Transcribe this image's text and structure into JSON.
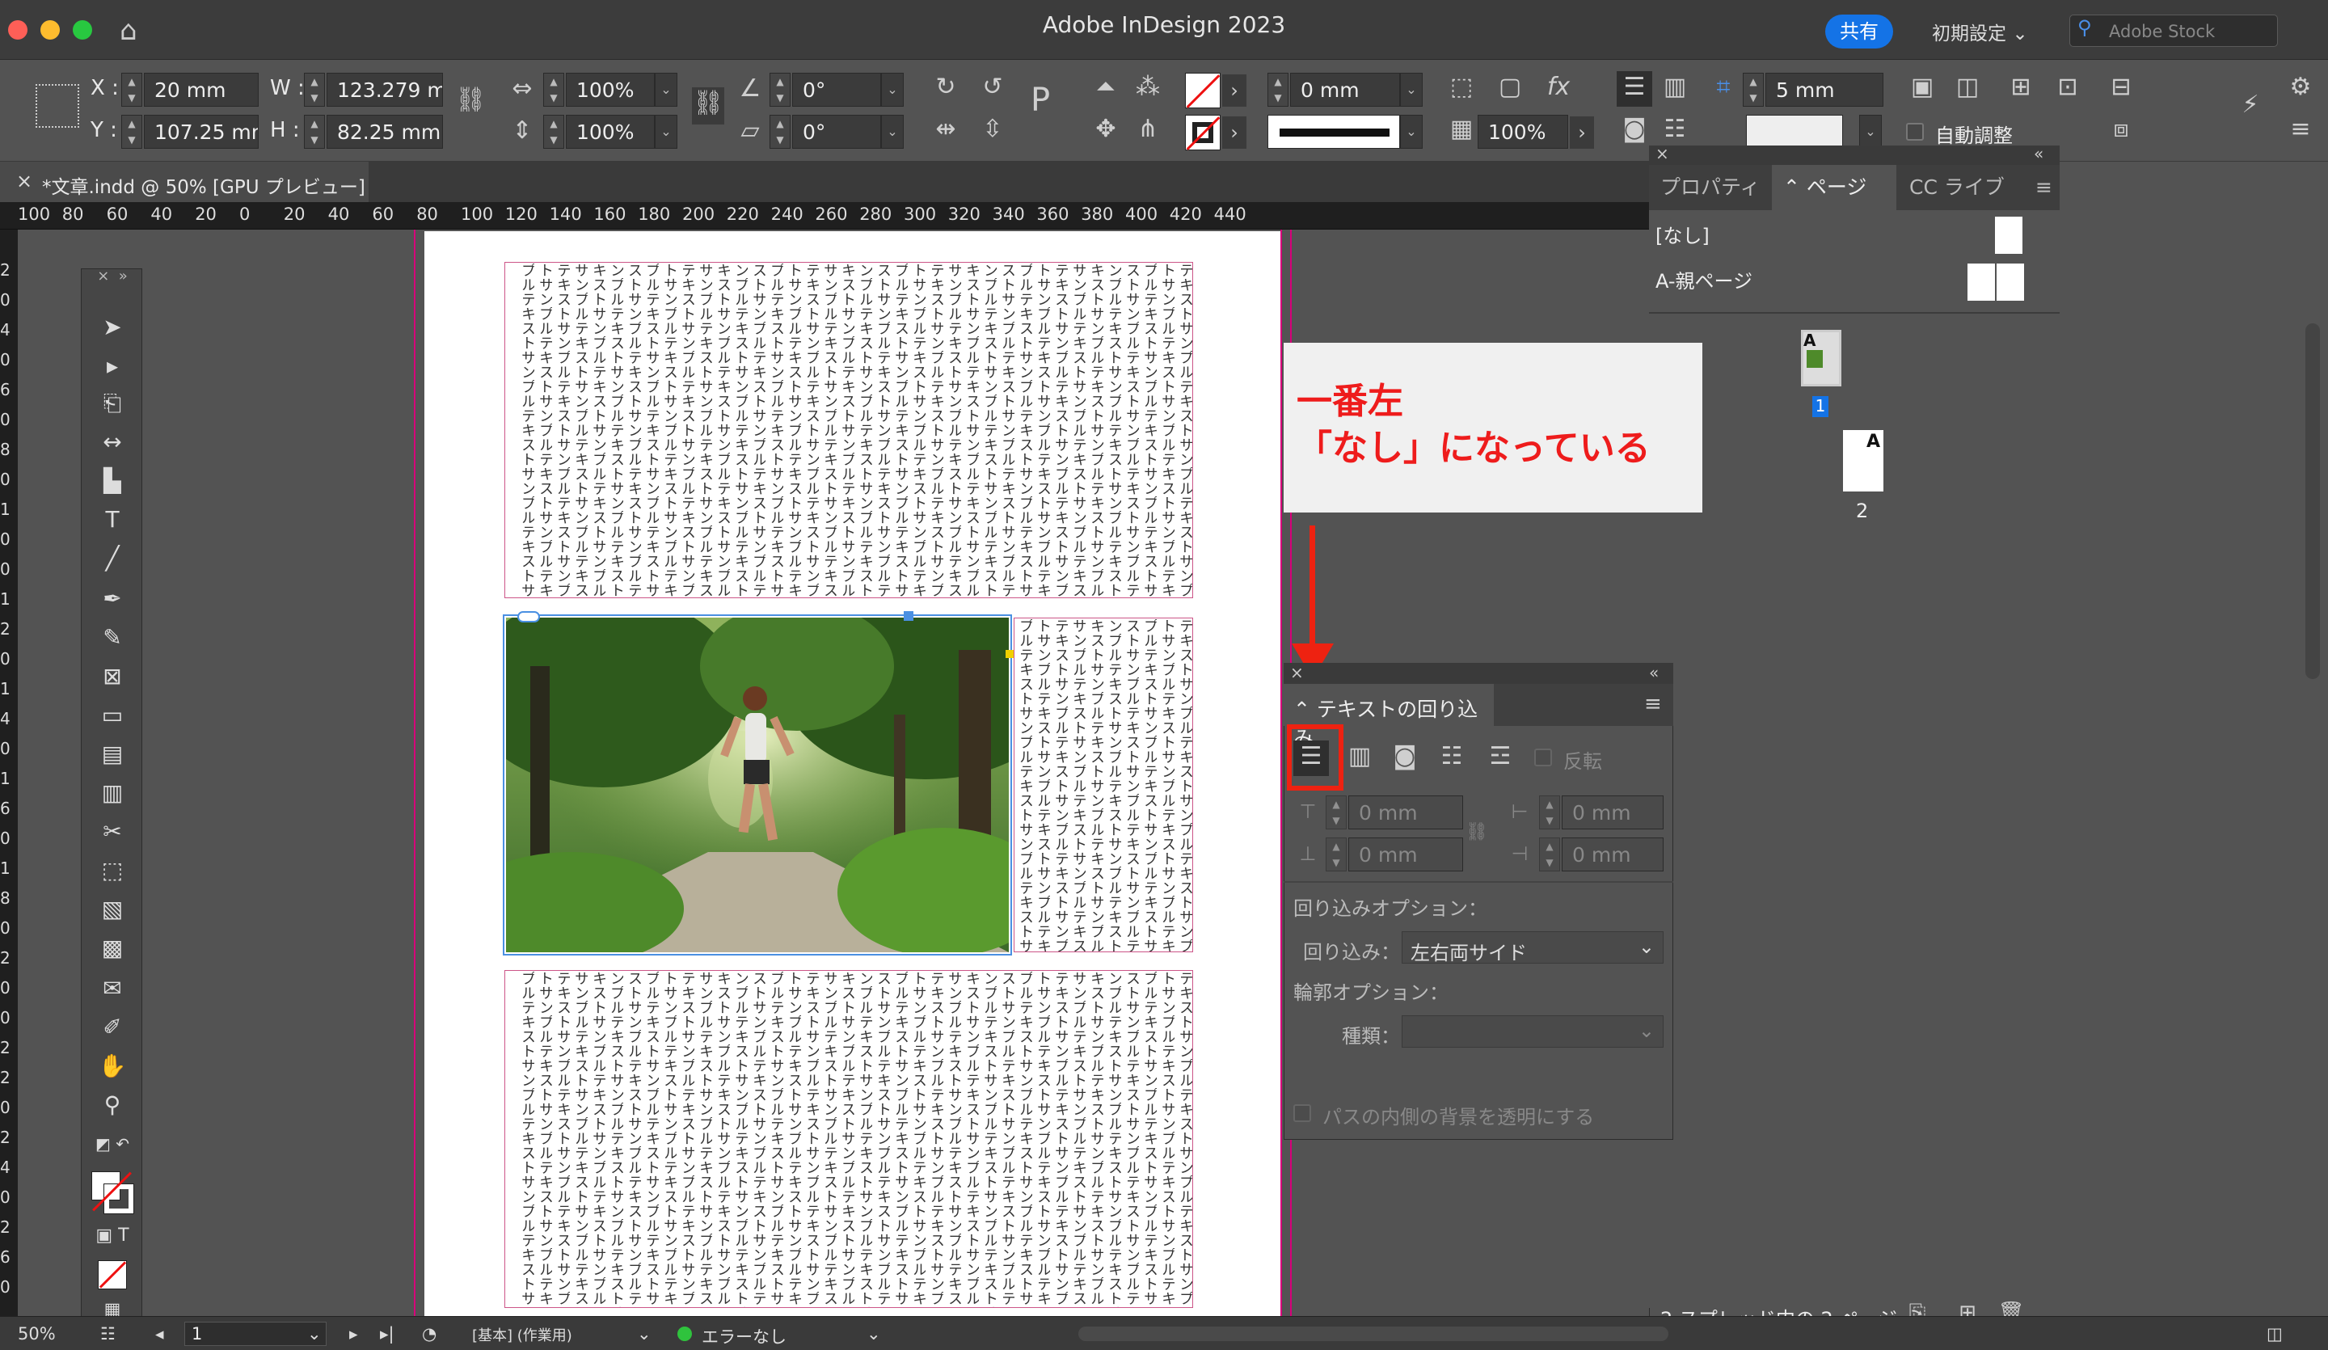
{
  "app": {
    "title": "Adobe InDesign 2023",
    "share_label": "共有",
    "workspace": "初期設定",
    "stock_placeholder": "Adobe Stock"
  },
  "control": {
    "x_label": "X :",
    "x_value": "20 mm",
    "y_label": "Y :",
    "y_value": "107.25 mm",
    "w_label": "W :",
    "w_value": "123.279 m",
    "h_label": "H :",
    "h_value": "82.25 mm",
    "scale_x": "100%",
    "scale_y": "100%",
    "rotate": "0°",
    "shear": "0°",
    "stroke_weight": "0 mm",
    "opacity": "100%",
    "offset": "5 mm",
    "autofit_label": "自動調整"
  },
  "document_tab": {
    "title": "*文章.indd @ 50% [GPU プレビュー]"
  },
  "ruler": {
    "ticks": [
      "100",
      "80",
      "60",
      "40",
      "20",
      "0",
      "20",
      "40",
      "60",
      "80",
      "100",
      "120",
      "140",
      "160",
      "180",
      "200",
      "220",
      "240",
      "260",
      "280",
      "300",
      "320",
      "340",
      "360",
      "380",
      "400",
      "420",
      "440"
    ],
    "vticks": [
      "2",
      "0",
      "4",
      "0",
      "6",
      "0",
      "8",
      "0",
      "1",
      "0",
      "0",
      "1",
      "2",
      "0",
      "1",
      "4",
      "0",
      "1",
      "6",
      "0",
      "1",
      "8",
      "0",
      "2",
      "0",
      "0",
      "2",
      "2",
      "0",
      "2",
      "4",
      "0",
      "2",
      "6",
      "0"
    ]
  },
  "sample_text": "テキストサンプルテキストサンプルテキストサンプルテキストサンプルテキストサンプルテキストサンプルテキストサンプル",
  "annotation": {
    "line1": "一番左",
    "line2": "「なし」になっている"
  },
  "right_panel": {
    "tabs": [
      "プロパティ",
      "ページ",
      "CC ライブ"
    ],
    "none_label": "[なし]",
    "master_label": "A-親ページ",
    "page1_num": "1",
    "page2_num": "2",
    "master_letter": "A",
    "footer": "2 スプレッド内の 2 ページ"
  },
  "wrap_panel": {
    "title": "テキストの回り込み",
    "invert_label": "反転",
    "offset_values": [
      "0 mm",
      "0 mm",
      "0 mm",
      "0 mm"
    ],
    "wrap_options_label": "回り込みオプション：",
    "wrap_to_label": "回り込み：",
    "wrap_to_value": "左右両サイド",
    "contour_label": "輪郭オプション：",
    "type_label": "種類：",
    "type_value": "",
    "transparent_label": "パスの内側の背景を透明にする"
  },
  "status": {
    "zoom": "50%",
    "page": "1",
    "style": "[基本] (作業用)",
    "preflight": "エラーなし"
  },
  "colors": {
    "accent": "#1473e6",
    "annotation_red": "#ee1c1c",
    "margin_magenta": "#d7007a"
  }
}
